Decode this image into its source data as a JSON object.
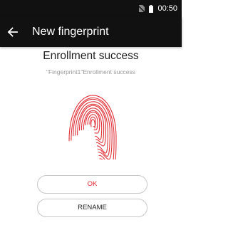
{
  "status_bar": {
    "time": "00:50",
    "sim_icon": "no-sim-icon",
    "battery_icon": "battery-icon"
  },
  "app_bar": {
    "back_icon": "arrow-left-icon",
    "title": "New fingerprint"
  },
  "main": {
    "heading": "Enrollment success",
    "subtext": "\"Fingerprint1\"Enrollment success",
    "fingerprint_icon": "fingerprint-icon",
    "fingerprint_color": "#e0323a"
  },
  "buttons": {
    "ok_label": "OK",
    "ok_color": "#e8262e",
    "rename_label": "RENAME"
  }
}
